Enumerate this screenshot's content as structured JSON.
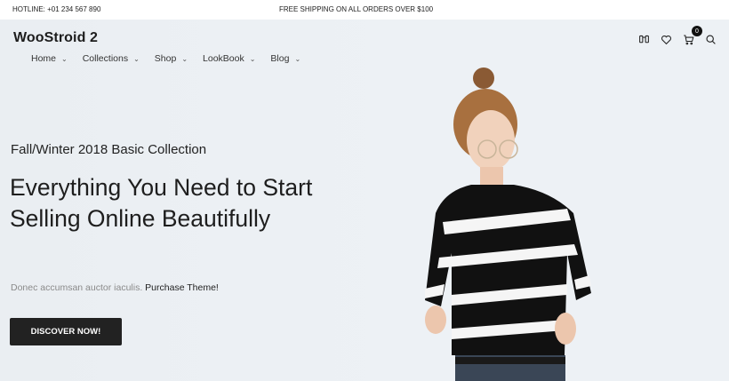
{
  "topbar": {
    "hotline": "HOTLINE: +01 234 567 890",
    "shipping": "FREE SHIPPING ON ALL ORDERS OVER $100"
  },
  "header": {
    "logo": "WooStroid 2",
    "nav": [
      {
        "label": "Home",
        "icon": "chevron-down-icon"
      },
      {
        "label": "Collections",
        "icon": "chevron-down-icon"
      },
      {
        "label": "Shop",
        "icon": "chevron-down-icon"
      },
      {
        "label": "LookBook",
        "icon": "chevron-down-icon"
      },
      {
        "label": "Blog",
        "icon": "chevron-down-icon"
      }
    ],
    "icons": {
      "compare": "compare-icon",
      "wishlist": "heart-icon",
      "cart": "cart-icon",
      "search": "search-icon"
    },
    "cart_count": "0"
  },
  "hero": {
    "subtitle": "Fall/Winter 2018 Basic Collection",
    "headline": "Everything You Need to Start Selling Online Beautifully",
    "description": "Donec accumsan auctor iaculis.",
    "description_link": "Purchase Theme!",
    "cta": "DISCOVER NOW!"
  },
  "colors": {
    "hero_bg": "#edf1f5",
    "button_bg": "#222222",
    "text_dark": "#1e1e1e",
    "text_muted": "#8a8a8a"
  }
}
